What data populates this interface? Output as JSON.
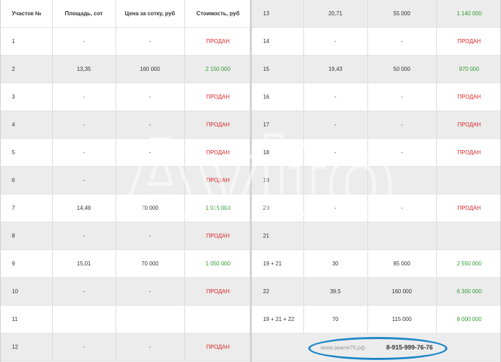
{
  "left_table": {
    "headers": [
      "Участок №",
      "Площадь, сот",
      "Цена за сотку, руб",
      "Стоимость, руб"
    ],
    "rows": [
      {
        "plot": "1",
        "area": "-",
        "price_per": "-",
        "cost": "ПРОДАН",
        "status": "sold"
      },
      {
        "plot": "2",
        "area": "13,35",
        "price_per": "160 000",
        "cost": "2 150 000",
        "status": "price"
      },
      {
        "plot": "3",
        "area": "-",
        "price_per": "-",
        "cost": "ПРОДАН",
        "status": "sold"
      },
      {
        "plot": "4",
        "area": "-",
        "price_per": "-",
        "cost": "ПРОДАН",
        "status": "sold"
      },
      {
        "plot": "5",
        "area": "-",
        "price_per": "-",
        "cost": "ПРОДАН",
        "status": "sold"
      },
      {
        "plot": "6",
        "area": "-",
        "price_per": "-",
        "cost": "ПРОДАН",
        "status": "sold"
      },
      {
        "plot": "7",
        "area": "14,49",
        "price_per": "70 000",
        "cost": "1 015 000",
        "status": "price"
      },
      {
        "plot": "8",
        "area": "-",
        "price_per": "-",
        "cost": "ПРОДАН",
        "status": "sold"
      },
      {
        "plot": "9",
        "area": "15,01",
        "price_per": "70 000",
        "cost": "1 050 000",
        "status": "price"
      },
      {
        "plot": "10",
        "area": "-",
        "price_per": "-",
        "cost": "ПРОДАН",
        "status": "sold"
      },
      {
        "plot": "11",
        "area": "",
        "price_per": "",
        "cost": "",
        "status": "none"
      },
      {
        "plot": "12",
        "area": "-",
        "price_per": "-",
        "cost": "ПРОДАН",
        "status": "sold"
      }
    ]
  },
  "right_table": {
    "rows": [
      {
        "plot": "13",
        "area": "20,71",
        "price_per": "55 000",
        "cost": "1 140 000",
        "status": "price"
      },
      {
        "plot": "14",
        "area": "-",
        "price_per": "-",
        "cost": "ПРОДАН",
        "status": "sold"
      },
      {
        "plot": "15",
        "area": "19,43",
        "price_per": "50 000",
        "cost": "970 000",
        "status": "price"
      },
      {
        "plot": "16",
        "area": "-",
        "price_per": "-",
        "cost": "ПРОДАН",
        "status": "sold"
      },
      {
        "plot": "17",
        "area": "-",
        "price_per": "-",
        "cost": "ПРОДАН",
        "status": "sold"
      },
      {
        "plot": "18",
        "area": "-",
        "price_per": "-",
        "cost": "ПРОДАН",
        "status": "sold"
      },
      {
        "plot": "19",
        "area": "",
        "price_per": "",
        "cost": "",
        "status": "none"
      },
      {
        "plot": "20",
        "area": "-",
        "price_per": "-",
        "cost": "ПРОДАН",
        "status": "sold"
      },
      {
        "plot": "21",
        "area": "",
        "price_per": "",
        "cost": "",
        "status": "none"
      },
      {
        "plot": "19 + 21",
        "area": "30",
        "price_per": "85 000",
        "cost": "2 550 000",
        "status": "price"
      },
      {
        "plot": "22",
        "area": "39,5",
        "price_per": "160 000",
        "cost": "6 300 000",
        "status": "price"
      },
      {
        "plot": "19 + 21 + 22",
        "area": "70",
        "price_per": "115 000",
        "cost": "8 000 000",
        "status": "price"
      }
    ]
  },
  "footer": {
    "site": "www.земля76.рф",
    "phone": "8-915-999-76-76"
  },
  "watermark": {
    "text": "Avito"
  },
  "colors": {
    "sold": "#e0262a",
    "price": "#2e9b2e",
    "ellipse": "#1b86c8"
  }
}
